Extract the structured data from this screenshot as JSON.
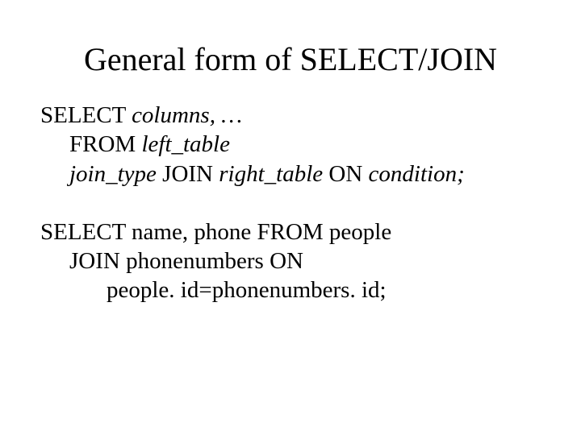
{
  "title": "General form of SELECT/JOIN",
  "syntax": {
    "line1": {
      "kw1": "SELECT ",
      "arg1": "columns, …"
    },
    "line2": {
      "kw1": "FROM ",
      "arg1": "left_table"
    },
    "line3": {
      "arg1": "join_type",
      "kw1": " JOIN ",
      "arg2": "right_table",
      "kw2": " ON ",
      "arg3": "condition;"
    }
  },
  "example": {
    "line1": "SELECT name, phone FROM people",
    "line2": "JOIN phonenumbers ON",
    "line3": "people. id=phonenumbers. id;"
  }
}
